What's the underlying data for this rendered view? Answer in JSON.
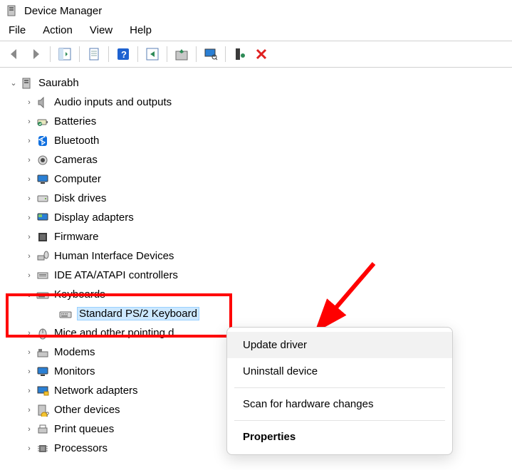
{
  "title": "Device Manager",
  "menu": {
    "file": "File",
    "action": "Action",
    "view": "View",
    "help": "Help"
  },
  "toolbar_icons": {
    "back": "back-icon",
    "forward": "forward-icon",
    "show_hide": "show-hide-tree-icon",
    "properties": "properties-sheet-icon",
    "help": "help-icon",
    "action_green": "action-icon",
    "update": "update-driver-icon",
    "monitor": "scan-hardware-icon",
    "sound": "add-legacy-icon",
    "remove": "remove-icon"
  },
  "root": {
    "label": "Saurabh"
  },
  "children": [
    {
      "label": "Audio inputs and outputs"
    },
    {
      "label": "Batteries"
    },
    {
      "label": "Bluetooth"
    },
    {
      "label": "Cameras"
    },
    {
      "label": "Computer"
    },
    {
      "label": "Disk drives"
    },
    {
      "label": "Display adapters"
    },
    {
      "label": "Firmware"
    },
    {
      "label": "Human Interface Devices"
    },
    {
      "label": "IDE ATA/ATAPI controllers"
    },
    {
      "label": "Keyboards"
    },
    {
      "label": "Mice and other pointing devices",
      "truncated": "Mice and other pointing d"
    },
    {
      "label": "Modems"
    },
    {
      "label": "Monitors"
    },
    {
      "label": "Network adapters"
    },
    {
      "label": "Other devices"
    },
    {
      "label": "Print queues"
    },
    {
      "label": "Processors"
    }
  ],
  "expanded_child": {
    "label": "Standard PS/2 Keyboard"
  },
  "context_menu": {
    "update": "Update driver",
    "uninstall": "Uninstall device",
    "scan": "Scan for hardware changes",
    "properties": "Properties"
  },
  "colors": {
    "selection_bg": "#cce8ff",
    "annotation": "#ff0000"
  }
}
